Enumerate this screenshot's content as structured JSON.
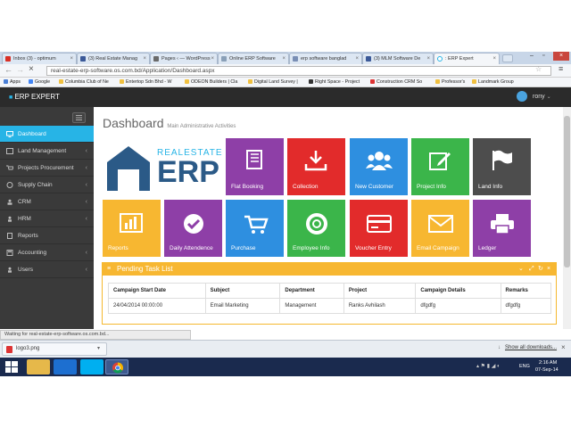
{
  "browser": {
    "tabs": [
      {
        "title": "Inbox (3) - optimum"
      },
      {
        "title": "(3) Real Estate Manag"
      },
      {
        "title": "Pages ‹ — WordPress"
      },
      {
        "title": "Online ERP Software"
      },
      {
        "title": "erp software banglad"
      },
      {
        "title": "(3) MLM Software De"
      },
      {
        "title": ": ERP Expert"
      }
    ],
    "url": "real-estate-erp-software.os.com.bd/Application/Dashboard.aspx",
    "bookmarks": [
      "Apps",
      "Google",
      "Columbia Club of Ne",
      "Entertop Sdn Bhd - W",
      "ODEON Builders | Cla",
      "Digital Land Survey |",
      "Right Space - Project",
      "Construction CRM So",
      "Professor's",
      "Landmark Group"
    ],
    "status_text": "Waiting for real-estate-erp-software.os.com.bd...",
    "download_file": "logo3.png",
    "show_downloads": "Show all downloads...",
    "tray_lang": "ENG",
    "tray_time": "2:16 AM",
    "tray_date": "07-Sep-14"
  },
  "app": {
    "brand": "ERP EXPERT",
    "user": "rony",
    "page_title": "Dashboard",
    "page_subtitle": "Main Administrative Activities",
    "logo_top": "REALESTATE",
    "logo_main": "ERP",
    "sidebar": [
      {
        "label": "Dashboard",
        "active": true,
        "chev": false
      },
      {
        "label": "Land Management",
        "active": false,
        "chev": true
      },
      {
        "label": "Projects Procurement",
        "active": false,
        "chev": true
      },
      {
        "label": "Supply Chain",
        "active": false,
        "chev": true
      },
      {
        "label": "CRM",
        "active": false,
        "chev": true
      },
      {
        "label": "HRM",
        "active": false,
        "chev": true
      },
      {
        "label": "Reports",
        "active": false,
        "chev": false
      },
      {
        "label": "Accounting",
        "active": false,
        "chev": true
      },
      {
        "label": "Users",
        "active": false,
        "chev": true
      }
    ],
    "tiles_row1": [
      {
        "label": "Flat Booking",
        "color": "#8e3fa7"
      },
      {
        "label": "Collection",
        "color": "#e22b2b"
      },
      {
        "label": "New Customer",
        "color": "#2e8fe0"
      },
      {
        "label": "Project Info",
        "color": "#3bb54a"
      },
      {
        "label": "Land Info",
        "color": "#4d4d4d"
      }
    ],
    "tiles_row2": [
      {
        "label": "Reports",
        "color": "#f7b731"
      },
      {
        "label": "Daily Attendence",
        "color": "#8e3fa7"
      },
      {
        "label": "Purchase",
        "color": "#2e8fe0"
      },
      {
        "label": "Employee Info",
        "color": "#3bb54a"
      },
      {
        "label": "Voucher Entry",
        "color": "#e22b2b"
      },
      {
        "label": "Email Campaign",
        "color": "#f7b731"
      },
      {
        "label": "Ledger",
        "color": "#8e3fa7"
      }
    ],
    "pending": {
      "title": "Pending Task List",
      "columns": [
        "Campaign Start Date",
        "Subject",
        "Department",
        "Project",
        "Campaign Details",
        "Remarks"
      ],
      "rows": [
        [
          "24/04/2014 00:00:00",
          "Email Marketing",
          "Management",
          "Ranks Avhilash",
          "dfgdfg",
          "dfgdfg"
        ]
      ]
    }
  }
}
